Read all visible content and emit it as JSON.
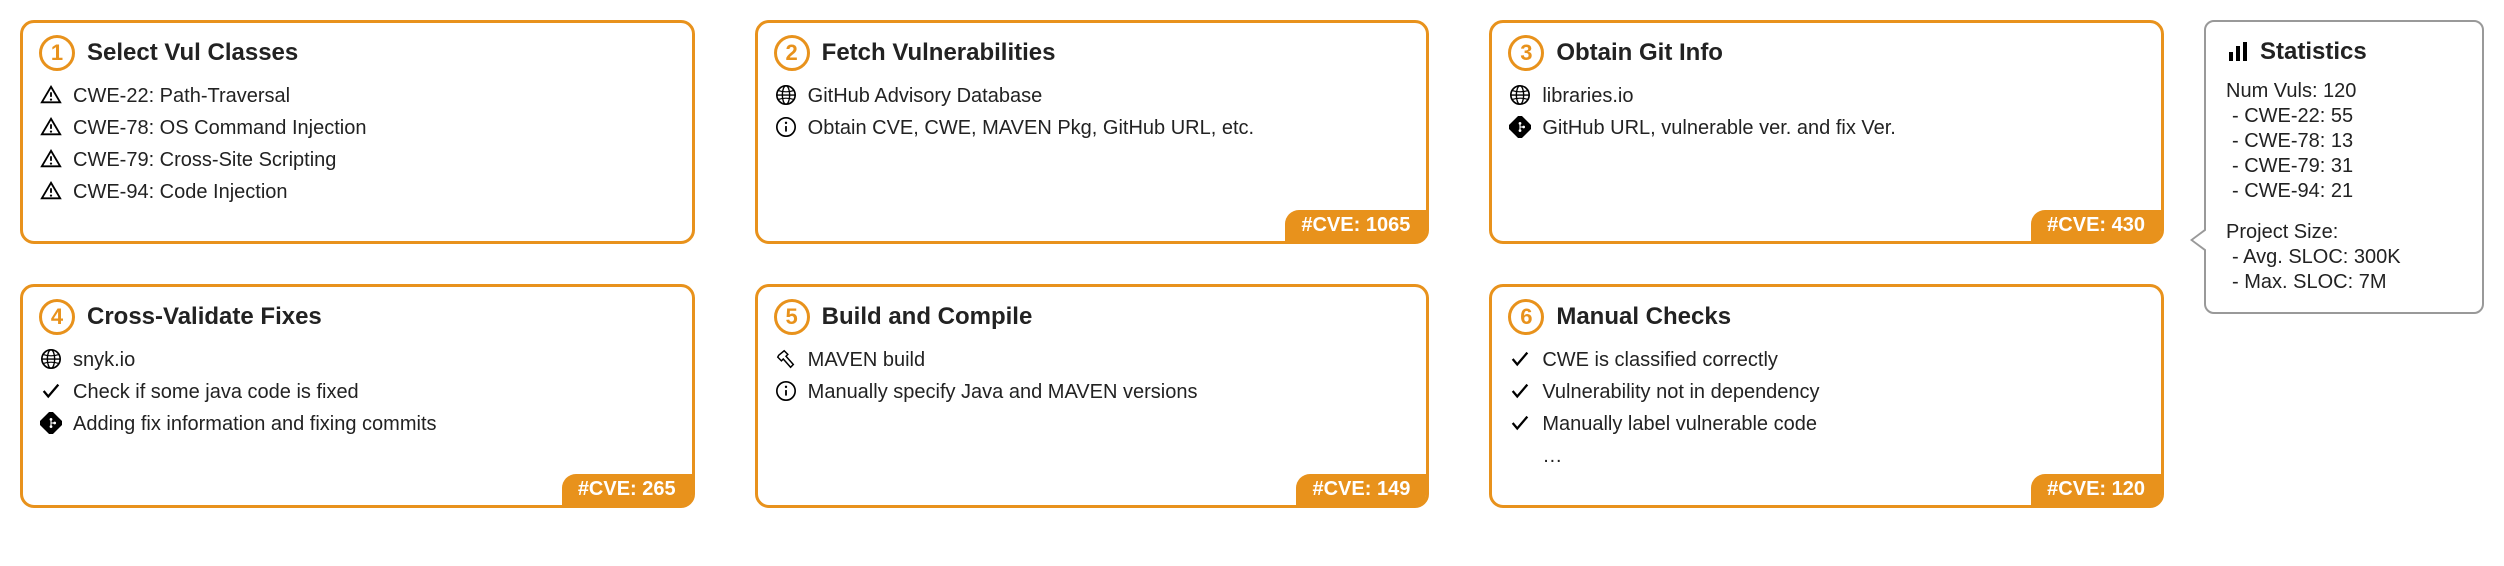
{
  "steps": [
    {
      "num": "1",
      "title": "Select Vul Classes",
      "items": [
        {
          "icon": "warning",
          "text": "CWE-22: Path-Traversal"
        },
        {
          "icon": "warning",
          "text": "CWE-78: OS Command Injection"
        },
        {
          "icon": "warning",
          "text": "CWE-79: Cross-Site Scripting"
        },
        {
          "icon": "warning",
          "text": "CWE-94: Code Injection"
        }
      ],
      "badge": null
    },
    {
      "num": "2",
      "title": "Fetch Vulnerabilities",
      "items": [
        {
          "icon": "globe",
          "text": "GitHub Advisory Database"
        },
        {
          "icon": "info",
          "text": "Obtain CVE, CWE, MAVEN Pkg, GitHub URL, etc."
        }
      ],
      "badge": "#CVE: 1065"
    },
    {
      "num": "3",
      "title": "Obtain Git Info",
      "items": [
        {
          "icon": "globe",
          "text": "libraries.io"
        },
        {
          "icon": "git",
          "text": "GitHub URL, vulnerable ver. and fix Ver."
        }
      ],
      "badge": "#CVE: 430"
    },
    {
      "num": "4",
      "title": "Cross-Validate Fixes",
      "items": [
        {
          "icon": "globe",
          "text": "snyk.io"
        },
        {
          "icon": "check",
          "text": "Check if some java code is fixed"
        },
        {
          "icon": "git",
          "text": "Adding fix information and fixing commits"
        }
      ],
      "badge": "#CVE: 265"
    },
    {
      "num": "5",
      "title": "Build and Compile",
      "items": [
        {
          "icon": "hammer",
          "text": "MAVEN build"
        },
        {
          "icon": "info",
          "text": "Manually specify Java and MAVEN versions"
        }
      ],
      "badge": "#CVE: 149"
    },
    {
      "num": "6",
      "title": "Manual Checks",
      "items": [
        {
          "icon": "check",
          "text": "CWE is classified correctly"
        },
        {
          "icon": "check",
          "text": "Vulnerability not in dependency"
        },
        {
          "icon": "check",
          "text": "Manually label vulnerable code"
        },
        {
          "icon": "none",
          "text": "…"
        }
      ],
      "badge": "#CVE: 120"
    }
  ],
  "stats": {
    "title": "Statistics",
    "lines": [
      "Num Vuls: 120",
      "- CWE-22: 55",
      "- CWE-78: 13",
      "- CWE-79: 31",
      "- CWE-94: 21"
    ],
    "project": [
      "Project Size:",
      "- Avg. SLOC: 300K",
      "- Max. SLOC: 7M"
    ]
  }
}
